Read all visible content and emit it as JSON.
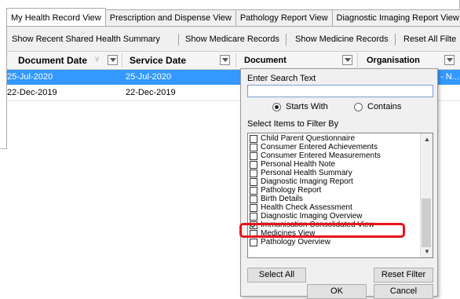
{
  "tabs": [
    {
      "label": "My Health Record View"
    },
    {
      "label": "Prescription and Dispense View"
    },
    {
      "label": "Pathology Report View"
    },
    {
      "label": "Diagnostic Imaging Report View"
    }
  ],
  "toolbar": {
    "recent_summary": "Show Recent Shared Health Summary",
    "medicare": "Show Medicare Records",
    "medicine": "Show Medicine Records",
    "reset_all": "Reset All Filte"
  },
  "columns": {
    "document_date": "Document Date",
    "service_date": "Service Date",
    "document": "Document",
    "organisation": "Organisation"
  },
  "rows": [
    {
      "document_date": "25-Jul-2020",
      "service_date": "25-Jul-2020",
      "org_fragment": "- N..."
    },
    {
      "document_date": "22-Dec-2019",
      "service_date": "22-Dec-2019",
      "org_fragment": ""
    }
  ],
  "filter_popup": {
    "search_label": "Enter Search Text",
    "search_value": "",
    "radio_starts_with": "Starts With",
    "radio_contains": "Contains",
    "selected_radio": "Starts With",
    "items_label": "Select Items to Filter By",
    "items": [
      {
        "label": "Child Parent Questionnaire",
        "checked": false
      },
      {
        "label": "Consumer Entered Achievements",
        "checked": false
      },
      {
        "label": "Consumer Entered Measurements",
        "checked": false
      },
      {
        "label": "Personal Health Note",
        "checked": false
      },
      {
        "label": "Personal Health Summary",
        "checked": false
      },
      {
        "label": "Diagnostic Imaging Report",
        "checked": false
      },
      {
        "label": "Pathology Report",
        "checked": false
      },
      {
        "label": "Birth Details",
        "checked": false
      },
      {
        "label": "Health Check Assessment",
        "checked": false
      },
      {
        "label": "Diagnostic Imaging Overview",
        "checked": false
      },
      {
        "label": "Immunisation Consolidated View",
        "checked": true
      },
      {
        "label": "Medicines View",
        "checked": false
      },
      {
        "label": "Pathology Overview",
        "checked": false
      }
    ],
    "select_all": "Select All",
    "reset_filter": "Reset Filter",
    "ok": "OK",
    "cancel": "Cancel"
  },
  "colors": {
    "selection": "#3399ff",
    "highlight_box": "#e8121b"
  }
}
